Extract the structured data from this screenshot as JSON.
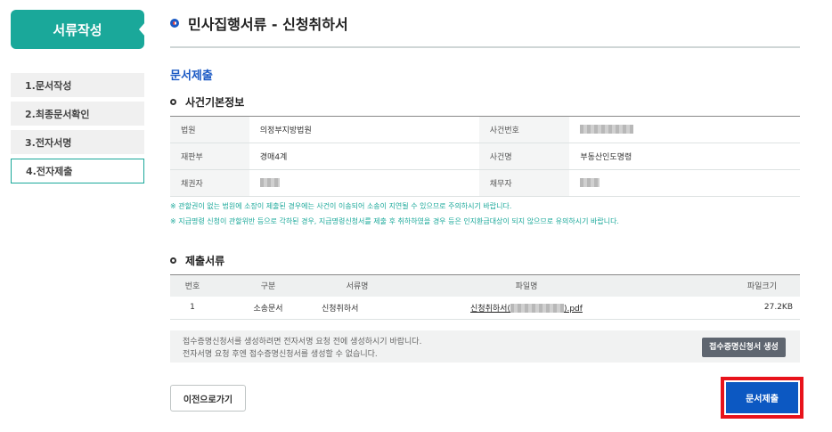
{
  "sidebar": {
    "header": "서류작성",
    "items": [
      {
        "label": "1.문서작성"
      },
      {
        "label": "2.최종문서확인"
      },
      {
        "label": "3.전자서명"
      },
      {
        "label": "4.전자제출"
      }
    ]
  },
  "page": {
    "title": "민사집행서류 - 신청취하서",
    "section": "문서제출"
  },
  "case_info": {
    "heading": "사건기본정보",
    "rows": [
      {
        "l1": "법원",
        "v1": "의정부지방법원",
        "l2": "사건번호",
        "v2": ""
      },
      {
        "l1": "재판부",
        "v1": "경매4계",
        "l2": "사건명",
        "v2": "부동산인도명령"
      },
      {
        "l1": "채권자",
        "v1": "",
        "l2": "채무자",
        "v2": ""
      }
    ]
  },
  "notices": [
    "※ 관할권이 없는 법원에 소장이 제출된 경우에는 사건이 이송되어 소송이 지연될 수 있으므로 주의하시기 바랍니다.",
    "※ 지급명령 신청이 관할위반 등으로 각하된 경우, 지급명령신청서를 제출 후 취하하였을 경우 등은 인지환급대상이 되지 않으므로 유의하시기 바랍니다."
  ],
  "files": {
    "heading": "제출서류",
    "columns": [
      "번호",
      "구분",
      "서류명",
      "파일명",
      "파일크기"
    ],
    "rows": [
      {
        "no": "1",
        "type": "소송문서",
        "doc": "신청취하서",
        "file_prefix": "신청취하서(",
        "file_suffix": ").pdf",
        "size": "27.2KB"
      }
    ]
  },
  "receipt": {
    "line1": "접수증명신청서를 생성하려면 전자서명 요청 전에 생성하시기 바랍니다.",
    "line2": "전자서명 요청 후엔 접수증명신청서를 생성할 수 없습니다.",
    "button": "접수증명신청서 생성"
  },
  "actions": {
    "prev": "이전으로가기",
    "submit": "문서제출"
  },
  "colors": {
    "accent_teal": "#1aa89a",
    "primary_blue": "#0c58c2",
    "highlight_red": "#e8131b"
  }
}
